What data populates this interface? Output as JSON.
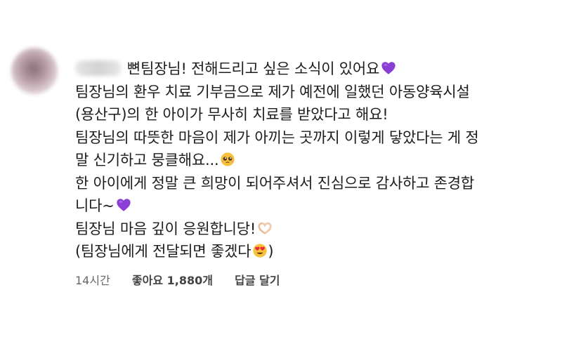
{
  "comment": {
    "lines": [
      "뼌팀장님! 전해드리고 싶은 소식이 있어요",
      "팀장님의 환우 치료 기부금으로 제가 예전에 일했던 아동양육시설",
      "(용산구)의 한 아이가 무사히 치료를 받았다고 해요!",
      "팀장님의 따뜻한 마음이 제가 아끼는 곳까지 이렇게 닿았다는 게 정",
      "말 신기하고 뭉클해요...",
      "한 아이에게 정말 큰 희망이 되어주셔서 진심으로 감사하고 존경합",
      "니다~",
      "팀장님 마음 깊이 응원합니당!",
      "(팀장님에게 전달되면 좋겠다",
      ")"
    ],
    "emojis": {
      "purple_heart": "purple-heart-icon",
      "pleading_face": "pleading-face-icon",
      "heart_hands": "heart-hands-icon",
      "heart_eyes": "heart-eyes-face-icon"
    }
  },
  "meta": {
    "time": "14시간",
    "likes": "좋아요 1,880개",
    "reply": "답글 달기"
  },
  "colors": {
    "text": "#1c1c1c",
    "meta": "#65676b",
    "purple_heart": "#8a3ed6"
  }
}
